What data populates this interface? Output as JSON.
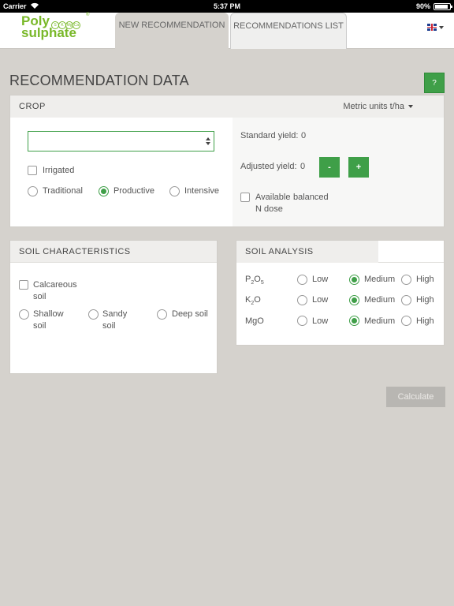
{
  "status_bar": {
    "carrier": "Carrier",
    "time": "5:37 PM",
    "battery": "90%",
    "battery_level": 0.9
  },
  "header": {
    "logo": {
      "line1": "Poly",
      "line2": "sulphate",
      "atoms": [
        "S",
        "K",
        "Mg",
        "Ca"
      ],
      "reg": "®"
    },
    "tabs": [
      {
        "label": "NEW RECOMMENDATION",
        "active": true
      },
      {
        "label": "RECOMMENDATIONS LIST",
        "active": false
      }
    ],
    "language_icon": "uk-flag-icon"
  },
  "page": {
    "title": "RECOMMENDATION DATA",
    "help_label": "?"
  },
  "crop": {
    "heading": "CROP",
    "units_label": "Metric units t/ha",
    "select_value": "",
    "irrigated_label": "Irrigated",
    "irrigated_checked": false,
    "systems": [
      {
        "label": "Traditional",
        "checked": false
      },
      {
        "label": "Productive",
        "checked": true
      },
      {
        "label": "Intensive",
        "checked": false
      }
    ],
    "standard_yield_label": "Standard yield:",
    "standard_yield_value": "0",
    "adjusted_yield_label": "Adjusted yield:",
    "adjusted_yield_value": "0",
    "minus_label": "-",
    "plus_label": "+",
    "n_dose_label_1": "Available",
    "n_dose_label_2": "balanced",
    "n_dose_label_3": "N dose",
    "n_dose_checked": false
  },
  "soil_characteristics": {
    "heading": "SOIL CHARACTERISTICS",
    "calcareous_line1": "Calcareous",
    "calcareous_line2": "soil",
    "calcareous_checked": false,
    "depths": [
      {
        "line1": "Shallow",
        "line2": "soil",
        "checked": false
      },
      {
        "line1": "Sandy",
        "line2": "soil",
        "checked": false
      },
      {
        "line1": "Deep soil",
        "line2": "",
        "checked": false
      }
    ]
  },
  "soil_analysis": {
    "heading": "SOIL ANALYSIS",
    "level_labels": [
      "Low",
      "Medium",
      "High"
    ],
    "nutrients": [
      {
        "symbol": "P",
        "sub1": "2",
        "mid": "O",
        "sub2": "5",
        "selected": "Medium"
      },
      {
        "symbol": "K",
        "sub1": "2",
        "mid": "O",
        "sub2": "",
        "selected": "Medium"
      },
      {
        "symbol": "MgO",
        "sub1": "",
        "mid": "",
        "sub2": "",
        "selected": "Medium"
      }
    ]
  },
  "calculate_label": "Calculate",
  "colors": {
    "accent": "#3f9f48",
    "brand": "#79b829",
    "background": "#d5d2cd"
  }
}
